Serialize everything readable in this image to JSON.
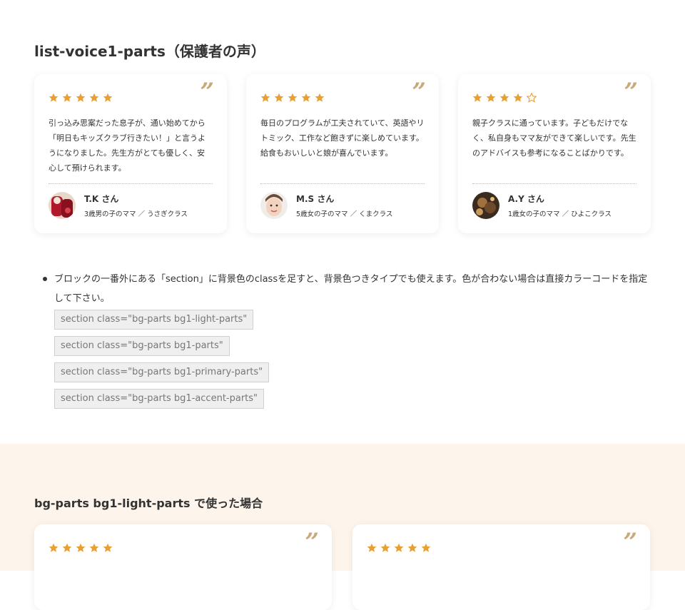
{
  "title": "list-voice1-parts（保護者の声）",
  "voices": [
    {
      "rating": 5,
      "text": "引っ込み思案だった息子が、通い始めてから「明日もキッズクラブ行きたい！」と言うようになりました。先生方がとても優しく、安心して預けられます。",
      "name": "T.K さん",
      "meta": "3歳男の子のママ ／ うさぎクラス",
      "avatar": "avatar-red-drink"
    },
    {
      "rating": 5,
      "text": "毎日のプログラムが工夫されていて、英語やリトミック、工作など飽きずに楽しめています。給食もおいしいと娘が喜んでいます。",
      "name": "M.S さん",
      "meta": "5歳女の子のママ ／ くまクラス",
      "avatar": "avatar-woman-face"
    },
    {
      "rating": 4,
      "text": "親子クラスに通っています。子どもだけでなく、私自身もママ友ができて楽しいです。先生のアドバイスも参考になることばかりです。",
      "name": "A.Y さん",
      "meta": "1歳女の子のママ ／ ひよこクラス",
      "avatar": "avatar-dark-photo"
    }
  ],
  "quote_mark": "”",
  "note": {
    "text": "ブロックの一番外にある「section」に背景色のclassを足すと、背景色つきタイプでも使えます。色が合わない場合は直接カラーコードを指定して下さい。",
    "codes": [
      "section class=\"bg-parts bg1-light-parts\"",
      "section class=\"bg-parts bg1-parts\"",
      "section class=\"bg-parts bg1-primary-parts\"",
      "section class=\"bg-parts bg1-accent-parts\""
    ]
  },
  "light_section": {
    "title": "bg-parts bg1-light-parts で使った場合",
    "voices": [
      {
        "rating": 5
      },
      {
        "rating": 5
      }
    ]
  },
  "colors": {
    "star": "#e8a030",
    "quote": "#c9a97b",
    "light_bg": "#fdf5ec"
  }
}
